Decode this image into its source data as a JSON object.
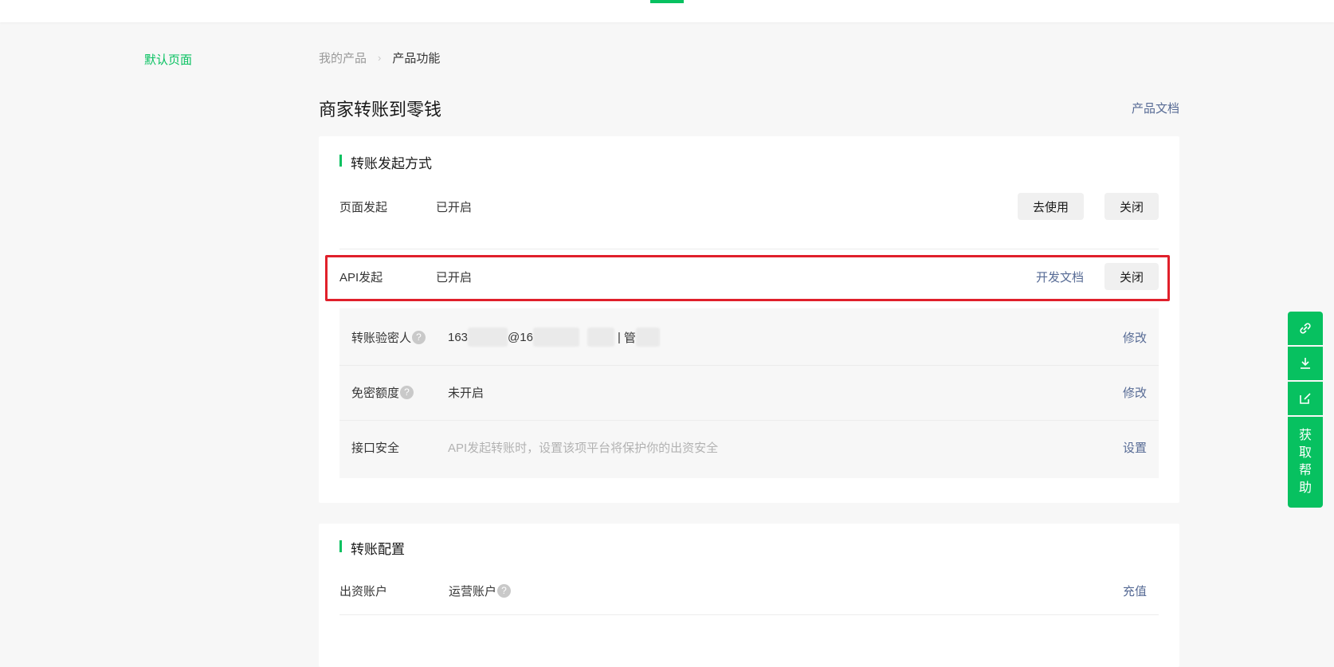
{
  "sidebar": {
    "default_page": "默认页面"
  },
  "breadcrumb": {
    "parent": "我的产品",
    "separator": ">",
    "current": "产品功能"
  },
  "page": {
    "title": "商家转账到零钱",
    "doc_link": "产品文档"
  },
  "transfer_methods": {
    "title": "转账发起方式",
    "page_initiate": {
      "label": "页面发起",
      "status": "已开启",
      "use_button": "去使用",
      "close_button": "关闭"
    },
    "api_initiate": {
      "label": "API发起",
      "status": "已开启",
      "doc_link": "开发文档",
      "close_button": "关闭"
    },
    "settings": [
      {
        "label": "转账验密人",
        "value_prefix": "163",
        "value_mid": "@16",
        "value_sep": "|",
        "value_suffix": "管",
        "action": "修改"
      },
      {
        "label": "免密额度",
        "value": "未开启",
        "action": "修改"
      },
      {
        "label": "接口安全",
        "value": "API发起转账时，设置该项平台将保护你的出资安全",
        "action": "设置"
      }
    ]
  },
  "transfer_config": {
    "title": "转账配置",
    "funding_account": {
      "label": "出资账户",
      "value": "运营账户",
      "action": "充值"
    }
  },
  "float_bar": {
    "help_chars": [
      "获",
      "取",
      "帮",
      "助"
    ]
  },
  "colors": {
    "brand": "#07c160",
    "link": "#576b95",
    "highlight": "#e0202b"
  },
  "icons": [
    "link-icon",
    "download-icon",
    "edit-icon"
  ]
}
